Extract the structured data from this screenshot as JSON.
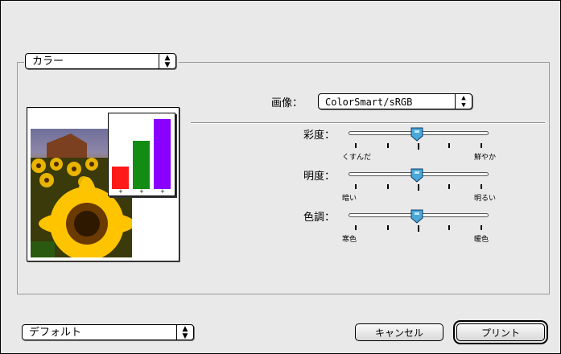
{
  "color_popup": {
    "label": "カラー",
    "arrows_icon": "up-down-arrows-icon"
  },
  "image_setting": {
    "label": "画像：",
    "selected": "ColorSmart/sRGB"
  },
  "sliders": [
    {
      "label": "彩度：",
      "left_caption": "くすんだ",
      "right_caption": "鮮やか",
      "value_fraction": 0.5
    },
    {
      "label": "明度：",
      "left_caption": "暗い",
      "right_caption": "明るい",
      "value_fraction": 0.5
    },
    {
      "label": "色調：",
      "left_caption": "寒色",
      "right_caption": "暖色",
      "value_fraction": 0.5
    }
  ],
  "preview_chart": {
    "colors": [
      "#ff1a1a",
      "#128c12",
      "#8a00ff"
    ],
    "values": [
      0.3,
      0.65,
      0.95
    ]
  },
  "preset_popup": {
    "label": "デフォルト"
  },
  "buttons": {
    "cancel": "キャンセル",
    "print": "プリント"
  }
}
